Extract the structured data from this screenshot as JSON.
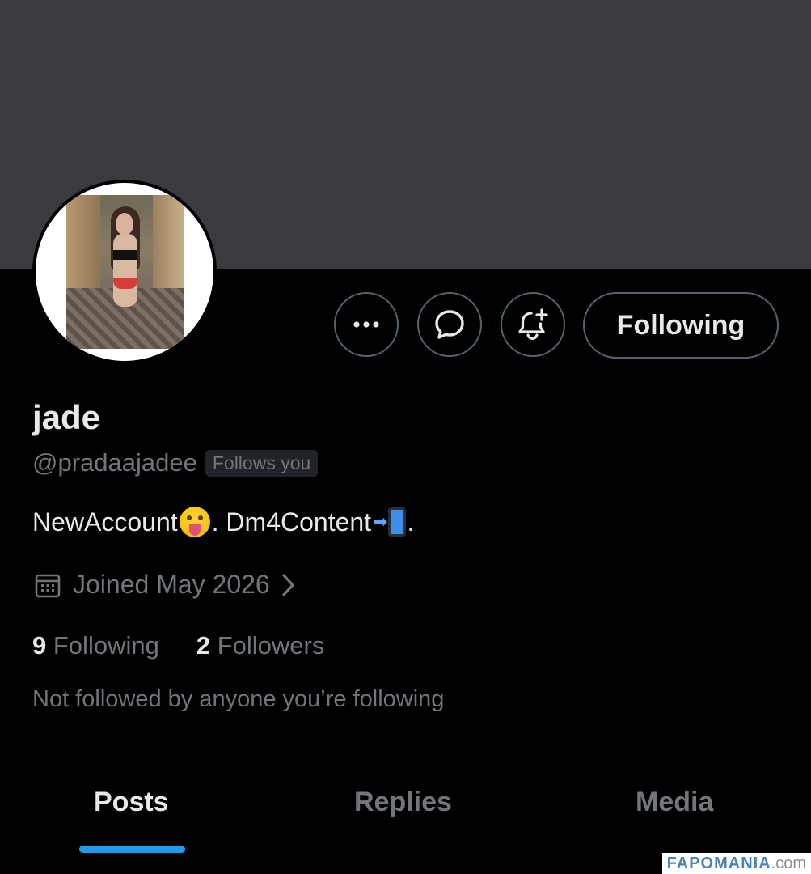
{
  "profile": {
    "display_name": "jade",
    "handle": "@pradaajadee",
    "follows_you_badge": "Follows you",
    "bio_part1": "NewAccount",
    "bio_part2": ". Dm4Content",
    "bio_part3": ".",
    "joined": "Joined May 2026",
    "following_count": "9",
    "following_label": "Following",
    "followers_count": "2",
    "followers_label": "Followers",
    "mutuals_text": "Not followed by anyone you’re following"
  },
  "actions": {
    "more_icon": "more-dots-icon",
    "message_icon": "chat-bubble-icon",
    "notify_icon": "bell-plus-icon",
    "follow_button_label": "Following"
  },
  "tabs": [
    {
      "label": "Posts",
      "active": true
    },
    {
      "label": "Replies",
      "active": false
    },
    {
      "label": "Media",
      "active": false
    }
  ],
  "colors": {
    "banner": "#3a3b3f",
    "accent": "#1d9bf0",
    "secondary_text": "#71767b"
  },
  "watermark": {
    "main": "FAPOMANIA",
    "suffix": ".com"
  }
}
